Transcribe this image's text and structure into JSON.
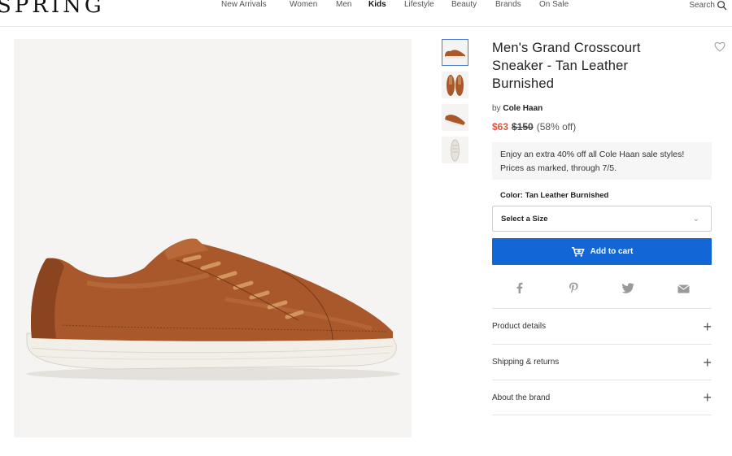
{
  "header": {
    "logo": "SPRING",
    "nav": [
      {
        "label": "New Arrivals",
        "bold": false
      },
      {
        "label": "Women",
        "bold": false
      },
      {
        "label": "Men",
        "bold": false
      },
      {
        "label": "Kids",
        "bold": true
      },
      {
        "label": "Lifestyle",
        "bold": false
      },
      {
        "label": "Beauty",
        "bold": false
      },
      {
        "label": "Brands",
        "bold": false
      },
      {
        "label": "On Sale",
        "bold": false
      }
    ],
    "search_label": "Search"
  },
  "product": {
    "title": "Men's Grand Crosscourt Sneaker - Tan Leather Burnished",
    "by_prefix": "by",
    "brand": "Cole Haan",
    "price_sale": "$63",
    "price_original": "$150",
    "price_off": "(58% off)",
    "promo": "Enjoy an extra 40% off all Cole Haan sale styles! Prices as marked, through 7/5.",
    "color_label": "Color:",
    "color_value": "Tan Leather Burnished",
    "size_placeholder": "Select a Size",
    "add_to_cart": "Add to cart"
  },
  "share_icons": [
    "facebook-icon",
    "pinterest-icon",
    "twitter-icon",
    "email-icon"
  ],
  "accordion": [
    {
      "label": "Product details"
    },
    {
      "label": "Shipping & returns"
    },
    {
      "label": "About the brand"
    }
  ],
  "colors": {
    "accent": "#1366d6",
    "sale": "#e0533e",
    "leather": "#a8582a",
    "sole": "#f2efe9"
  }
}
